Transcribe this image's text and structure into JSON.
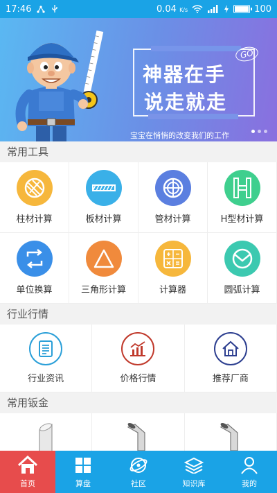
{
  "status_bar": {
    "time": "17:46",
    "network_speed": "0.04",
    "speed_unit": "K/s",
    "battery": "100",
    "battery_level": 1.0
  },
  "banner": {
    "headline_line1": "神器在手",
    "headline_line2": "说走就走",
    "badge": "GO",
    "subtitle": "宝宝在悄悄的改变我们的工作",
    "slide_count": 3,
    "active_slide": 1
  },
  "sections": {
    "tools": "常用工具",
    "industry": "行业行情",
    "metal": "常用钣金"
  },
  "tools": [
    {
      "label": "柱材计算",
      "icon": "column-calc-icon",
      "color": "#f6b73c"
    },
    {
      "label": "板材计算",
      "icon": "plate-calc-icon",
      "color": "#3ab0e8"
    },
    {
      "label": "管材计算",
      "icon": "pipe-calc-icon",
      "color": "#5b7fe0"
    },
    {
      "label": "H型材计算",
      "icon": "h-beam-calc-icon",
      "color": "#3fcf8e"
    },
    {
      "label": "单位换算",
      "icon": "unit-convert-icon",
      "color": "#3a8fe8"
    },
    {
      "label": "三角形计算",
      "icon": "triangle-calc-icon",
      "color": "#f08a3c"
    },
    {
      "label": "计算器",
      "icon": "calculator-icon",
      "color": "#f6b73c"
    },
    {
      "label": "圆弧计算",
      "icon": "arc-calc-icon",
      "color": "#3cc9b0"
    }
  ],
  "industry": [
    {
      "label": "行业资讯",
      "icon": "news-icon",
      "color": "#2a9fd8"
    },
    {
      "label": "价格行情",
      "icon": "price-chart-icon",
      "color": "#c0392b"
    },
    {
      "label": "推荐厂商",
      "icon": "factory-home-icon",
      "color": "#2c3e8f"
    }
  ],
  "tabs": [
    {
      "label": "首页",
      "icon": "home-icon",
      "active": true
    },
    {
      "label": "算盘",
      "icon": "grid-icon",
      "active": false
    },
    {
      "label": "社区",
      "icon": "community-icon",
      "active": false
    },
    {
      "label": "知识库",
      "icon": "books-icon",
      "active": false
    },
    {
      "label": "我的",
      "icon": "user-icon",
      "active": false
    }
  ],
  "colors": {
    "primary": "#1aa3e6",
    "tab_active": "#e74c4c"
  }
}
